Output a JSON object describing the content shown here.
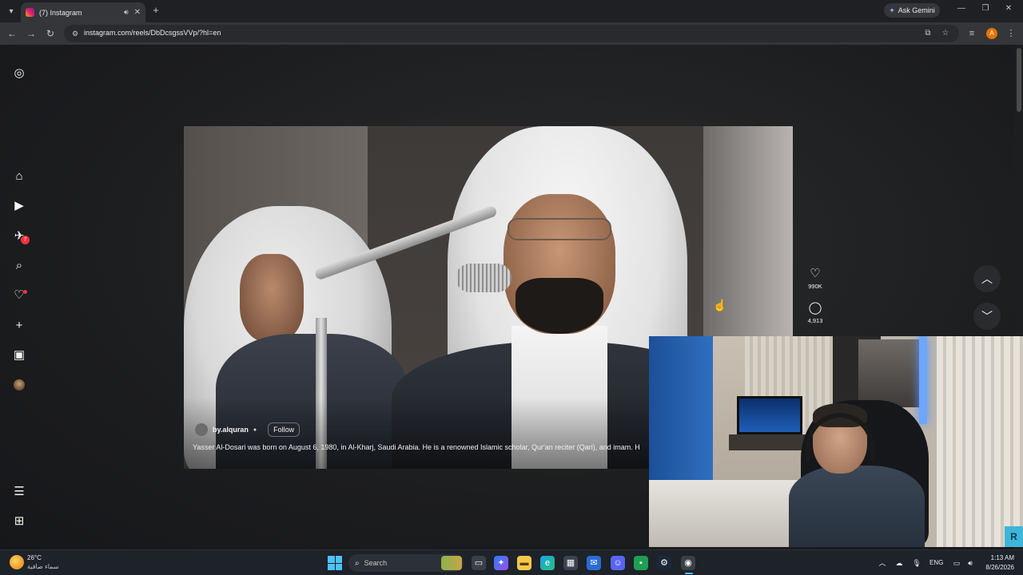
{
  "browser": {
    "tab_title": "(7) Instagram",
    "new_tab": "+",
    "gemini_label": "Ask Gemini",
    "url": "instagram.com/reels/DbDcsgssVVp/?hl=en",
    "profile_initial": "A"
  },
  "sidebar": {
    "notifications_badge": "7"
  },
  "reel": {
    "author": "by.alquran",
    "follow_label": "Follow",
    "caption": "Yasser Al-Dosari was born on August 6, 1980, in Al-Kharj, Saudi Arabia. He is a renowned Islamic scholar, Qur'an reciter (Qari), and imam. H",
    "likes": "990K",
    "comments": "4,913"
  },
  "taskbar": {
    "temperature": "26°C",
    "weather_desc": "سماء صافية",
    "search_label": "Search",
    "language": "ENG",
    "time": "1:13 AM",
    "date": "8/26/2026"
  },
  "webcam": {
    "logo_text": "R"
  },
  "colors": {
    "accent": "#4cc2ff",
    "badge": "#ff3040",
    "page_bg": "#1c1d1f"
  }
}
